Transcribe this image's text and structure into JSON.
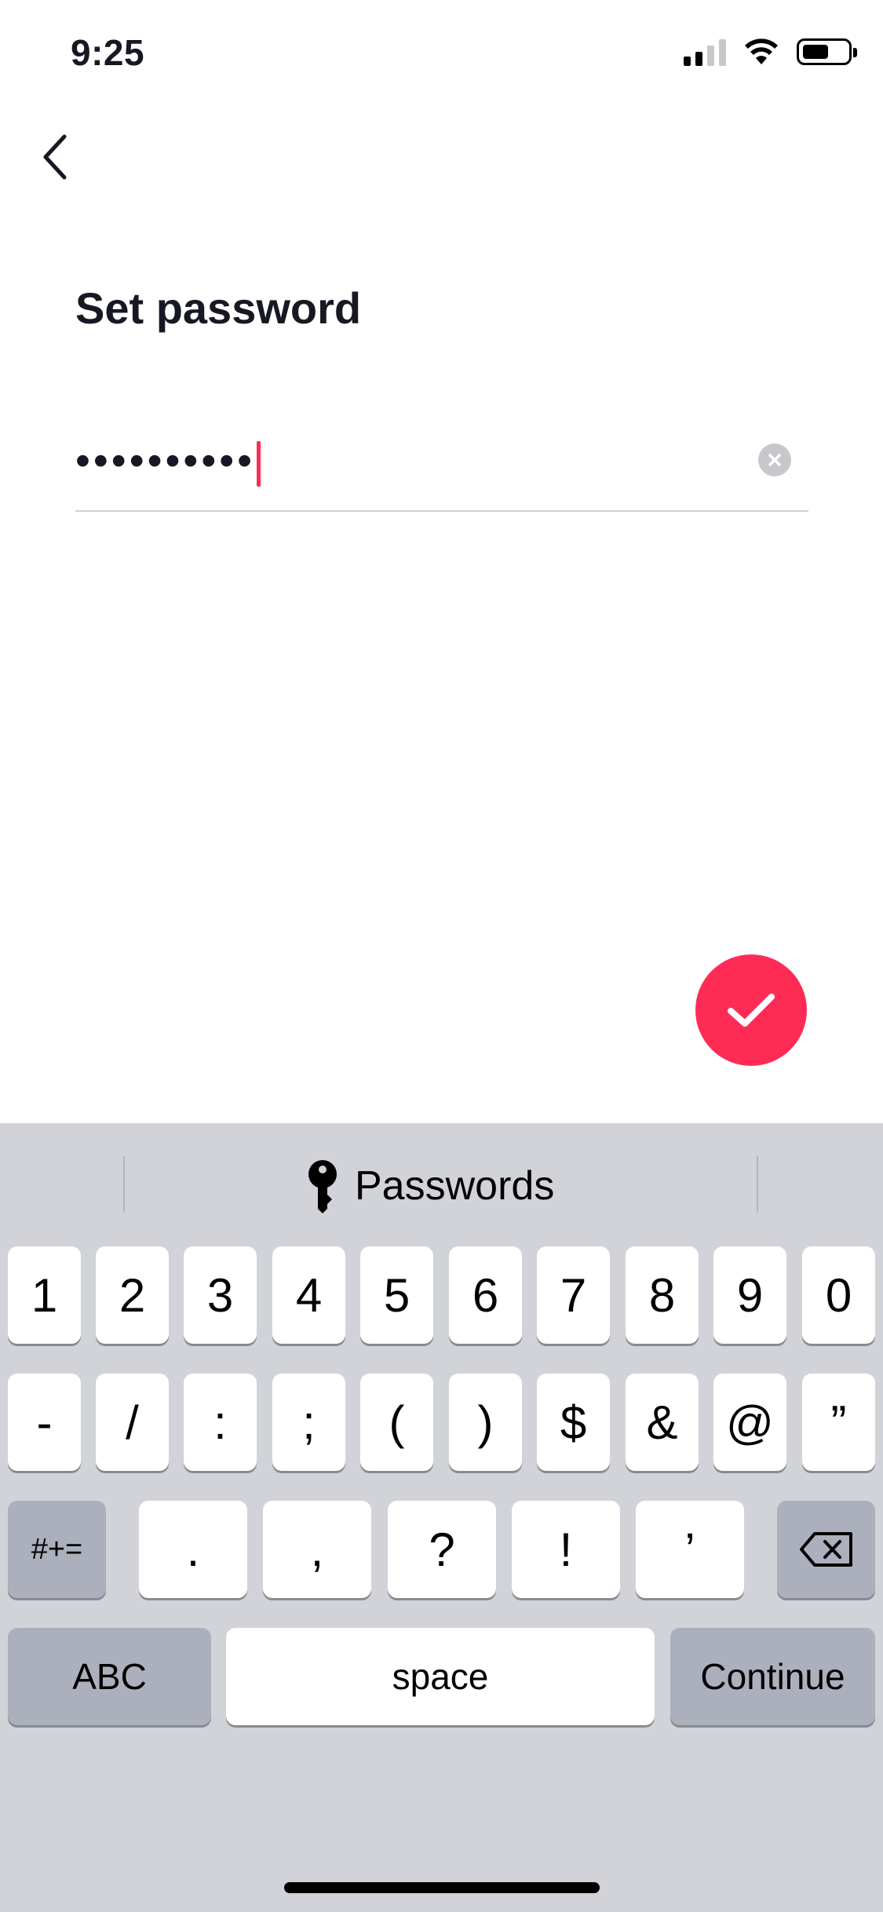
{
  "status_bar": {
    "time": "9:25"
  },
  "screen": {
    "title": "Set password",
    "password_masked": "••••••••••"
  },
  "colors": {
    "accent": "#fe2c55",
    "keyboard_bg": "#d1d3d9",
    "text": "#161823"
  },
  "icons": {
    "back": "chevron-left-icon",
    "clear": "clear-x-icon",
    "confirm": "checkmark-icon",
    "key": "key-icon",
    "backspace": "backspace-icon"
  },
  "keyboard": {
    "suggestion_label": "Passwords",
    "row1": [
      "1",
      "2",
      "3",
      "4",
      "5",
      "6",
      "7",
      "8",
      "9",
      "0"
    ],
    "row2": [
      "-",
      "/",
      ":",
      ";",
      "(",
      ")",
      "$",
      "&",
      "@",
      "”"
    ],
    "row3": [
      ".",
      ",",
      "?",
      "!",
      "’"
    ],
    "symbols_key": "#+=",
    "abc_key": "ABC",
    "space_key": "space",
    "return_key": "Continue"
  }
}
